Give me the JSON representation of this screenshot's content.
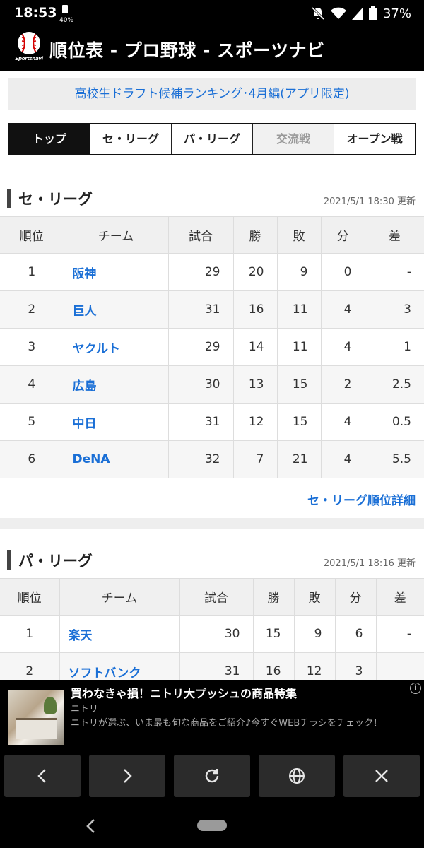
{
  "status_bar": {
    "time": "18:53",
    "battery_small": "40%",
    "battery": "37%"
  },
  "header": {
    "title": "順位表 - プロ野球 - スポーツナビ",
    "logo_text": "Sportsnavi"
  },
  "promo": {
    "text": "高校生ドラフト候補ランキング･4月編(アプリ限定)"
  },
  "tabs": [
    {
      "label": "トップ"
    },
    {
      "label": "セ・リーグ"
    },
    {
      "label": "パ・リーグ"
    },
    {
      "label": "交流戦"
    },
    {
      "label": "オープン戦"
    }
  ],
  "central": {
    "title": "セ・リーグ",
    "updated": "2021/5/1 18:30 更新",
    "columns": [
      "順位",
      "チーム",
      "試合",
      "勝",
      "敗",
      "分",
      "差"
    ],
    "rows": [
      [
        "1",
        "阪神",
        "29",
        "20",
        "9",
        "0",
        "-"
      ],
      [
        "2",
        "巨人",
        "31",
        "16",
        "11",
        "4",
        "3"
      ],
      [
        "3",
        "ヤクルト",
        "29",
        "14",
        "11",
        "4",
        "1"
      ],
      [
        "4",
        "広島",
        "30",
        "13",
        "15",
        "2",
        "2.5"
      ],
      [
        "5",
        "中日",
        "31",
        "12",
        "15",
        "4",
        "0.5"
      ],
      [
        "6",
        "DeNA",
        "32",
        "7",
        "21",
        "4",
        "5.5"
      ]
    ],
    "detail_link": "セ・リーグ順位詳細"
  },
  "pacific": {
    "title": "パ・リーグ",
    "updated": "2021/5/1 18:16 更新",
    "columns": [
      "順位",
      "チーム",
      "試合",
      "勝",
      "敗",
      "分",
      "差"
    ],
    "rows": [
      [
        "1",
        "楽天",
        "30",
        "15",
        "9",
        "6",
        "-"
      ],
      [
        "2",
        "ソフトバンク",
        "31",
        "16",
        "12",
        "3",
        ""
      ]
    ]
  },
  "ad": {
    "title": "買わなきゃ損！ニトリ大プッシュの商品特集",
    "brand": "ニトリ",
    "description": "ニトリが選ぶ、いま最も旬な商品をご紹介♪今すぐWEBチラシをチェック！"
  },
  "toolbar_icons": [
    "chevron-left-icon",
    "chevron-right-icon",
    "reload-icon",
    "globe-icon",
    "close-icon"
  ]
}
